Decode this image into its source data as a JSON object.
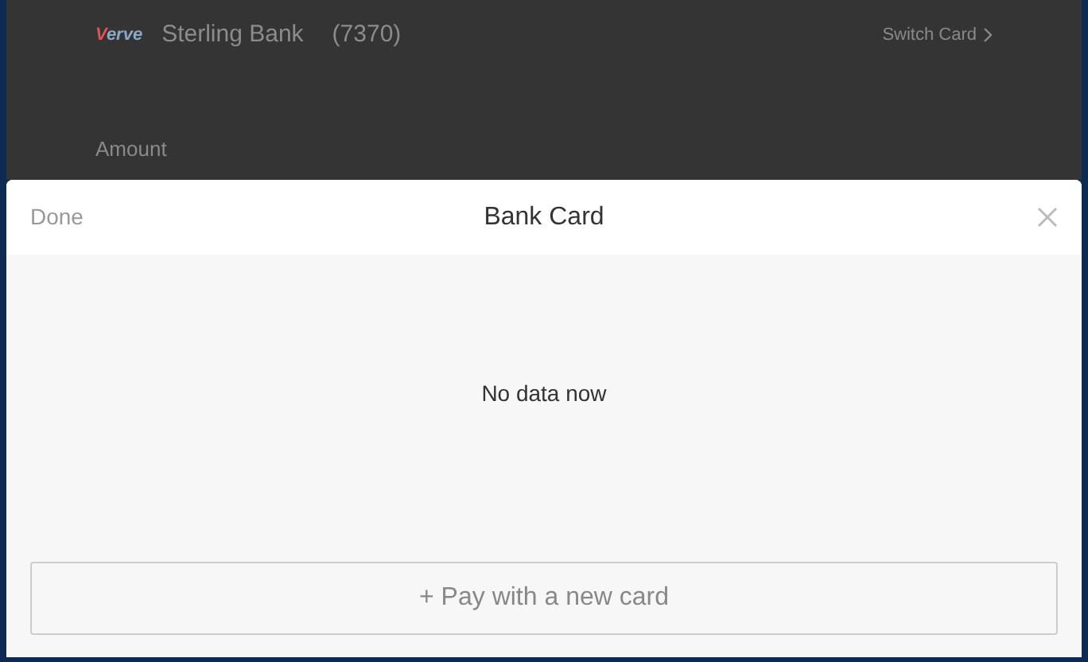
{
  "background_page": {
    "card": {
      "logo": "Verve",
      "bank": "Sterling Bank",
      "number": "(7370)",
      "switch_label": "Switch Card"
    },
    "amount_label": "Amount"
  },
  "sheet": {
    "done_label": "Done",
    "title": "Bank Card",
    "empty_message": "No data now",
    "add_button": "+ Pay with a new card"
  }
}
